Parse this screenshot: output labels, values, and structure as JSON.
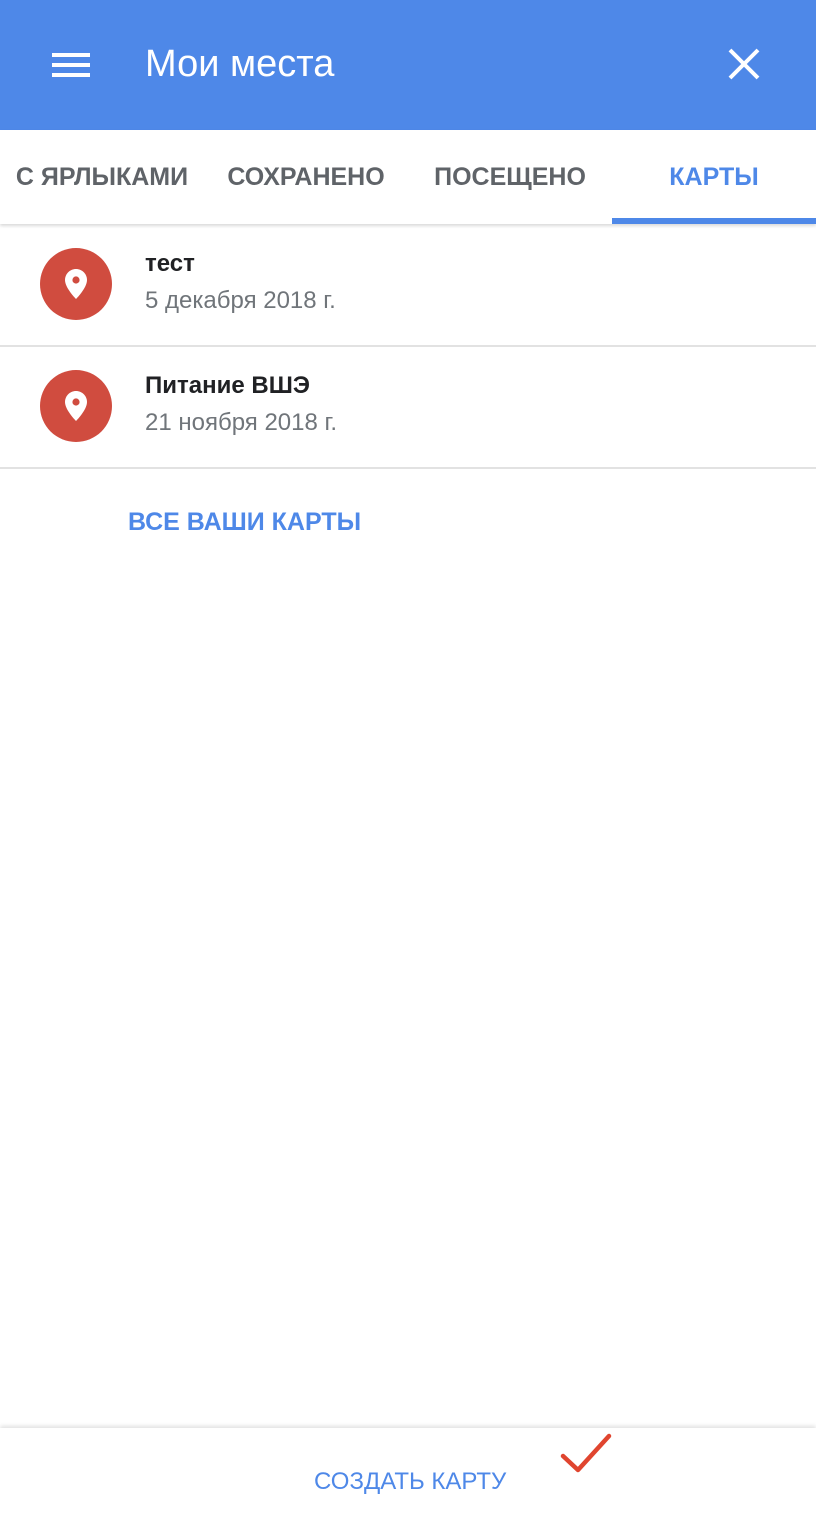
{
  "app_bar": {
    "title": "Мои места",
    "background_color": "#4e88e8",
    "menu_icon": "hamburger-menu-icon",
    "close_icon": "close-icon"
  },
  "tabs": [
    {
      "label": "С ЯРЛЫКАМИ",
      "selected": false
    },
    {
      "label": "СОХРАНЕНО",
      "selected": false
    },
    {
      "label": "ПОСЕЩЕНО",
      "selected": false
    },
    {
      "label": "КАРТЫ",
      "selected": true
    }
  ],
  "maps": [
    {
      "title": "тест",
      "date": "5 декабря 2018 г.",
      "icon": "map-pin-icon"
    },
    {
      "title": "Питание ВШЭ",
      "date": "21 ноября 2018 г.",
      "icon": "map-pin-icon"
    }
  ],
  "all_maps_link": "ВСЕ ВАШИ КАРТЫ",
  "bottom_bar": {
    "create_map_label": "СОЗДАТЬ КАРТУ",
    "annotation_icon": "red-checkmark-icon"
  },
  "colors": {
    "accent": "#4e88e8",
    "pin": "#d04c3f",
    "checkmark": "#e0452f"
  }
}
